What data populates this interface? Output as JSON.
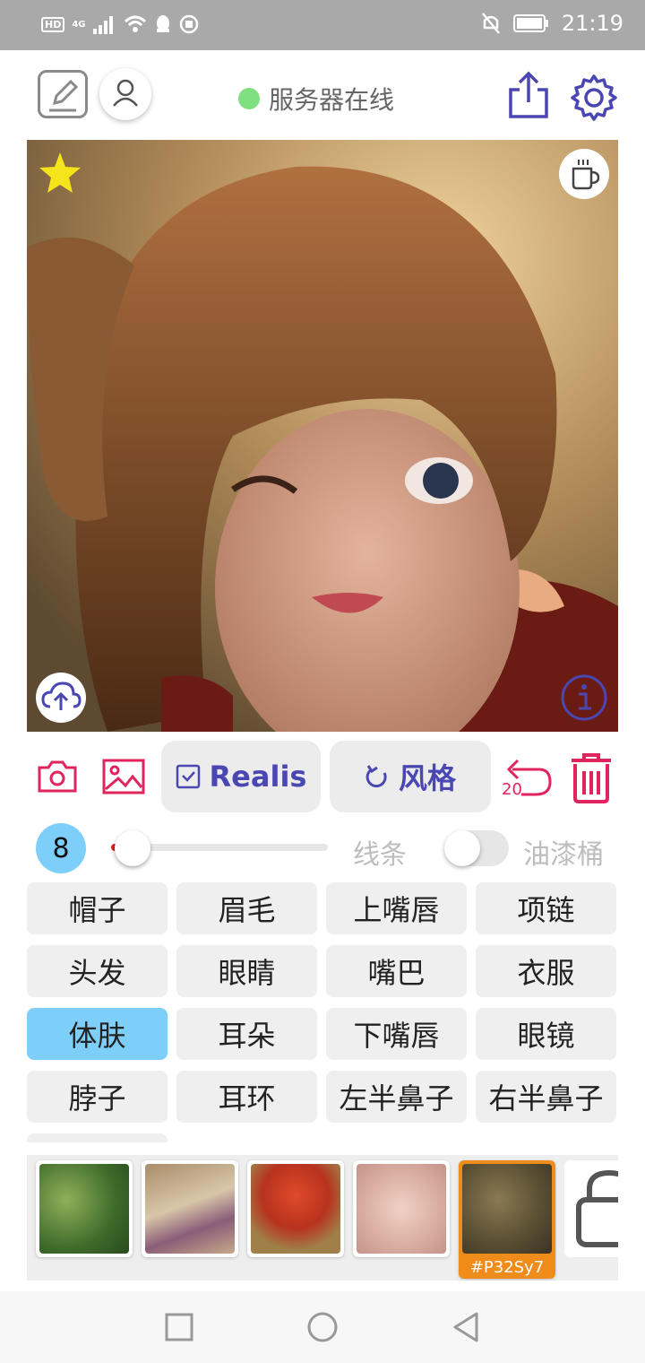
{
  "status_bar": {
    "time": "21:19",
    "network": "4G",
    "hd": "HD"
  },
  "header": {
    "server_status": "服务器在线"
  },
  "toolbar": {
    "realis_label": "Realis",
    "style_label": "风格",
    "undo_count": "20"
  },
  "controls": {
    "brush_size": "8",
    "line_label": "线条",
    "bucket_label": "油漆桶"
  },
  "parts": [
    [
      "帽子",
      "眉毛",
      "上嘴唇",
      "项链"
    ],
    [
      "头发",
      "眼睛",
      "嘴巴",
      "衣服"
    ],
    [
      "体肤",
      "耳朵",
      "下嘴唇",
      "眼镜"
    ],
    [
      "脖子",
      "耳环",
      "左半鼻子",
      "右半鼻子"
    ]
  ],
  "active_part": "体肤",
  "thumbnails": [
    {
      "caption": ""
    },
    {
      "caption": ""
    },
    {
      "caption": ""
    },
    {
      "caption": ""
    },
    {
      "caption": "#P32Sy7"
    }
  ],
  "colors": {
    "accent": "#4a47b3",
    "danger": "#e0245e",
    "highlight": "#7dcff9",
    "online": "#7ee07e",
    "selected_thumb": "#f08c1a"
  }
}
